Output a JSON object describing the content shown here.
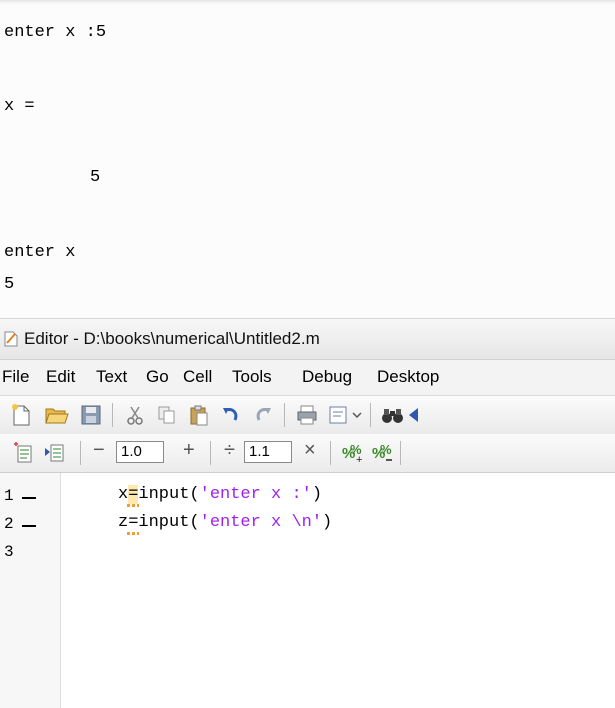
{
  "command_window": {
    "lines": [
      "enter x :5",
      "x =",
      "5",
      "enter x",
      "5"
    ]
  },
  "editor": {
    "title": "Editor - D:\\books\\numerical\\Untitled2.m",
    "menu": [
      "File",
      "Edit",
      "Text",
      "Go",
      "Cell",
      "Tools",
      "Debug",
      "Desktop"
    ],
    "toolbar": {
      "zoom_minus": "−",
      "zoom_value": "1.0",
      "zoom_plus": "+",
      "divide": "÷",
      "divide_value": "1.1",
      "times": "×"
    },
    "code_lines": [
      {
        "num": "1",
        "var": "x",
        "eq": "=",
        "func": "input(",
        "str": "'enter x :'",
        "close": ")"
      },
      {
        "num": "2",
        "var": "z",
        "eq": "=",
        "func": "input(",
        "str": "'enter x \\n'",
        "close": ")"
      },
      {
        "num": "3"
      }
    ],
    "colors": {
      "string": "#a020f0",
      "warning_underline": "#f0a030"
    }
  }
}
